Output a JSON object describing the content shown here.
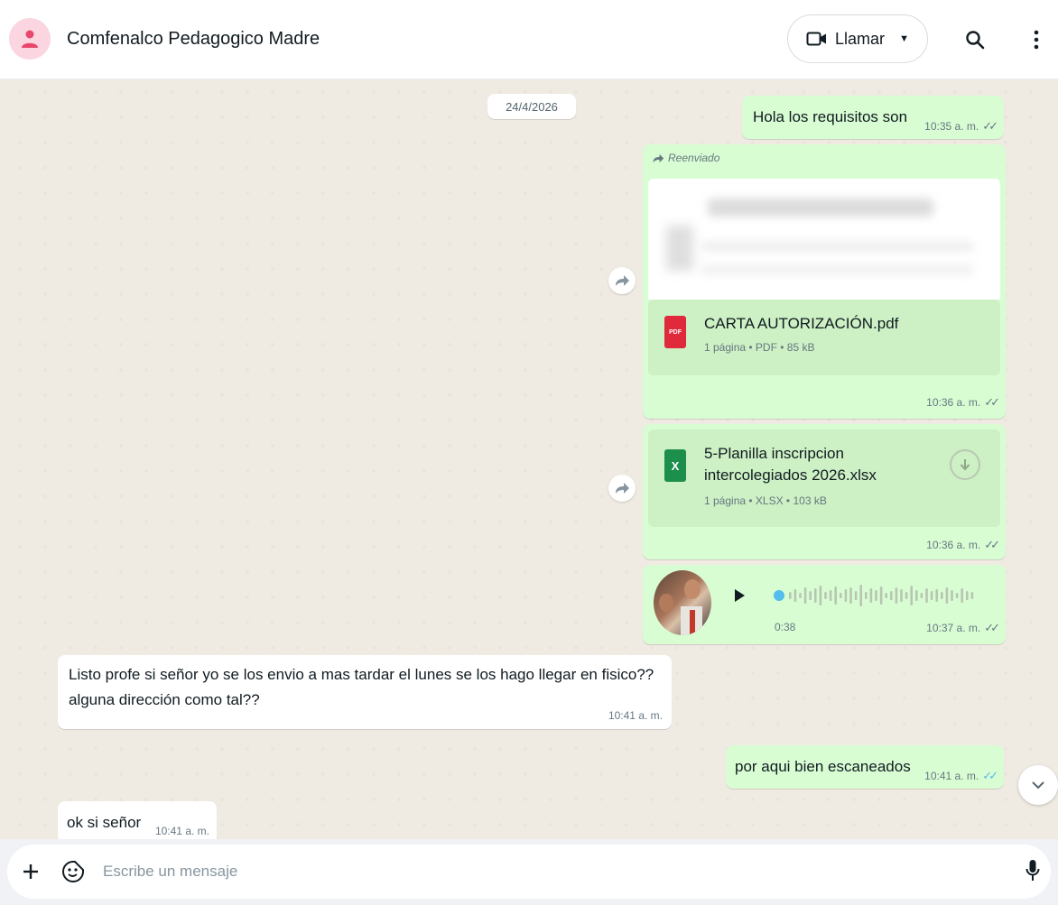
{
  "header": {
    "contact_name": "Comfenalco Pedagogico Madre",
    "call_label": "Llamar"
  },
  "chat": {
    "date_separator": "24/4/2026",
    "messages": [
      {
        "text": "Hola los requisitos son",
        "time": "10:35 a. m."
      },
      {
        "forwarded_label": "Reenviado",
        "file_name": "CARTA AUTORIZACIÓN.pdf",
        "file_info": "1 página • PDF • 85 kB",
        "file_type": "PDF",
        "time": "10:36 a. m."
      },
      {
        "file_name_line1": "5-Planilla inscripcion",
        "file_name_line2": "intercolegiados 2026.xlsx",
        "file_info": "1 página • XLSX • 103 kB",
        "file_type": "X",
        "time": "10:36 a. m."
      },
      {
        "duration": "0:38",
        "time": "10:37 a. m.",
        "progress": 0
      },
      {
        "line1": "Listo profe si señor yo se los envio a mas tardar el lunes se los hago llegar en fisico??",
        "line2": "alguna dirección como tal??",
        "time": "10:41 a. m."
      },
      {
        "text": "por aqui bien escaneados",
        "time": "10:41 a. m."
      },
      {
        "text": "ok si señor",
        "time": "10:41 a. m."
      }
    ]
  },
  "composer": {
    "placeholder": "Escribe un mensaje"
  },
  "colors": {
    "outgoing_bubble": "#d9fdd3",
    "incoming_bubble": "#ffffff",
    "chat_background": "#efeae2",
    "read_ticks": "#53bdeb",
    "pdf_icon": "#e0293b",
    "xlsx_icon": "#1d8f4c"
  }
}
